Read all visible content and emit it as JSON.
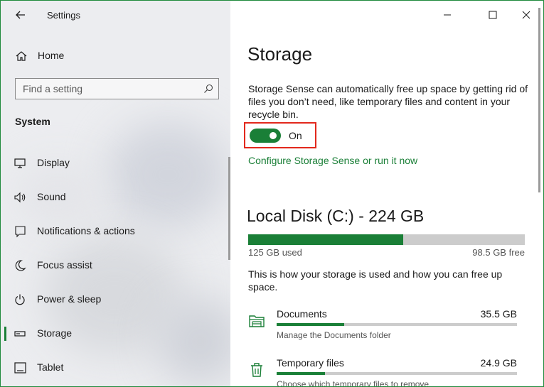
{
  "window": {
    "app_title": "Settings"
  },
  "sidebar": {
    "home_label": "Home",
    "search_placeholder": "Find a setting",
    "section_label": "System",
    "items": [
      {
        "label": "Display",
        "icon": "display-icon"
      },
      {
        "label": "Sound",
        "icon": "sound-icon"
      },
      {
        "label": "Notifications & actions",
        "icon": "notifications-icon"
      },
      {
        "label": "Focus assist",
        "icon": "focus-assist-icon"
      },
      {
        "label": "Power & sleep",
        "icon": "power-icon"
      },
      {
        "label": "Storage",
        "icon": "storage-icon",
        "active": true
      },
      {
        "label": "Tablet",
        "icon": "tablet-icon"
      }
    ]
  },
  "main": {
    "title": "Storage",
    "description": "Storage Sense can automatically free up space by getting rid of files you don’t need, like temporary files and content in your recycle bin.",
    "toggle": {
      "state": "On",
      "enabled": true
    },
    "configure_link": "Configure Storage Sense or run it now",
    "disk": {
      "title": "Local Disk (C:) - 224 GB",
      "used_label": "125 GB used",
      "free_label": "98.5 GB free",
      "used_fraction": 0.56
    },
    "usage_info": "This is how your storage is used and how you can free up space.",
    "categories": [
      {
        "name": "Documents",
        "size": "35.5 GB",
        "sub": "Manage the Documents folder",
        "fraction": 0.28,
        "icon": "folder-icon"
      },
      {
        "name": "Temporary files",
        "size": "24.9 GB",
        "sub": "Choose which temporary files to remove",
        "fraction": 0.2,
        "icon": "trash-icon"
      }
    ]
  },
  "colors": {
    "accent": "#1a7f37",
    "highlight_border": "#e2281c"
  }
}
